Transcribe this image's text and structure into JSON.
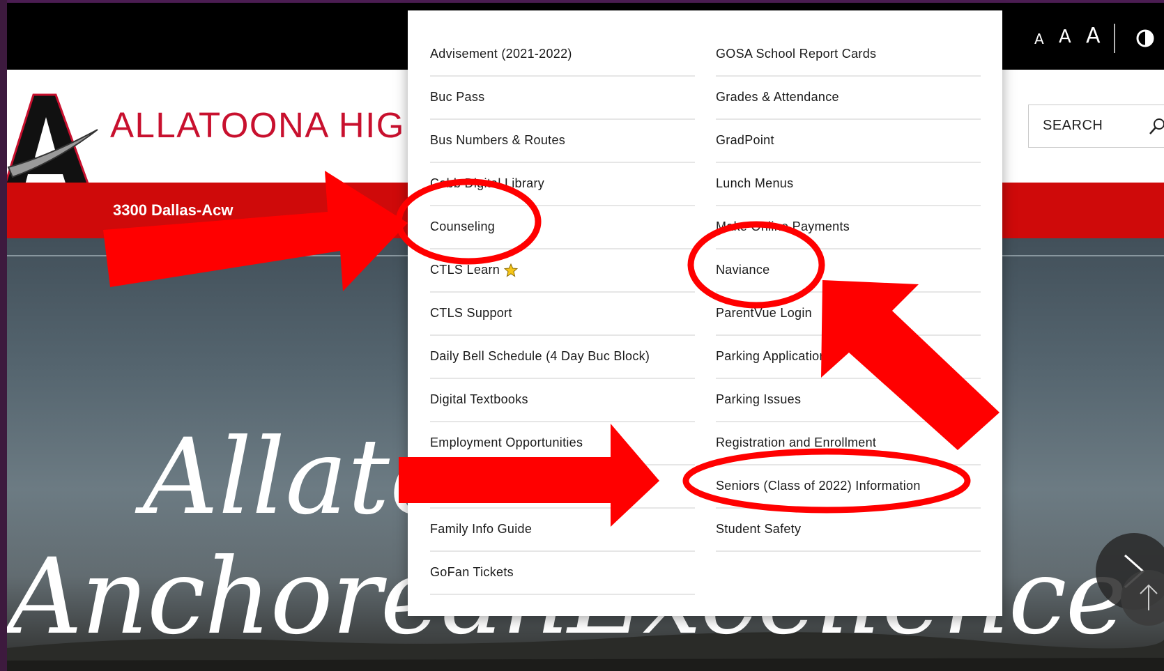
{
  "colors": {
    "accent": "#cf0a0a",
    "brand_red": "#c8102e",
    "topbar": "#000000",
    "annotation": "#ff0000",
    "frame": "#3d1a3e"
  },
  "topbar": {
    "text_size_small": "A",
    "text_size_medium": "A",
    "text_size_large": "A",
    "contrast_icon": "contrast-icon"
  },
  "header": {
    "school_name": "ALLATOONA HIG",
    "search_label": "SEARCH",
    "search_icon": "search-icon",
    "address": "3300 Dallas-Acw"
  },
  "hero": {
    "line1": "Allato",
    "line2": "AnchoreаnExcellence"
  },
  "quick_links": {
    "left": [
      "Advisement (2021-2022)",
      "Buc Pass",
      "Bus Numbers & Routes",
      "Cobb Digital Library",
      "Counseling",
      "CTLS Learn",
      "CTLS Support",
      "Daily Bell Schedule (4 Day Buc Block)",
      "Digital Textbooks",
      "Employment Opportunities",
      "",
      "Family Info Guide",
      "GoFan Tickets"
    ],
    "right": [
      "GOSA School Report Cards",
      "Grades & Attendance",
      "GradPoint",
      "Lunch Menus",
      "Make Online Payments",
      "Naviance",
      "ParentVue Login",
      "Parking Application (F",
      "Parking Issues",
      "Registration and Enrollment",
      "Seniors (Class of 2022) Information",
      "Student Safety"
    ],
    "ctls_learn_icon": "star-icon"
  },
  "annotations": {
    "highlighted": [
      "Counseling",
      "Naviance",
      "Seniors (Class of 2022) Information"
    ]
  }
}
